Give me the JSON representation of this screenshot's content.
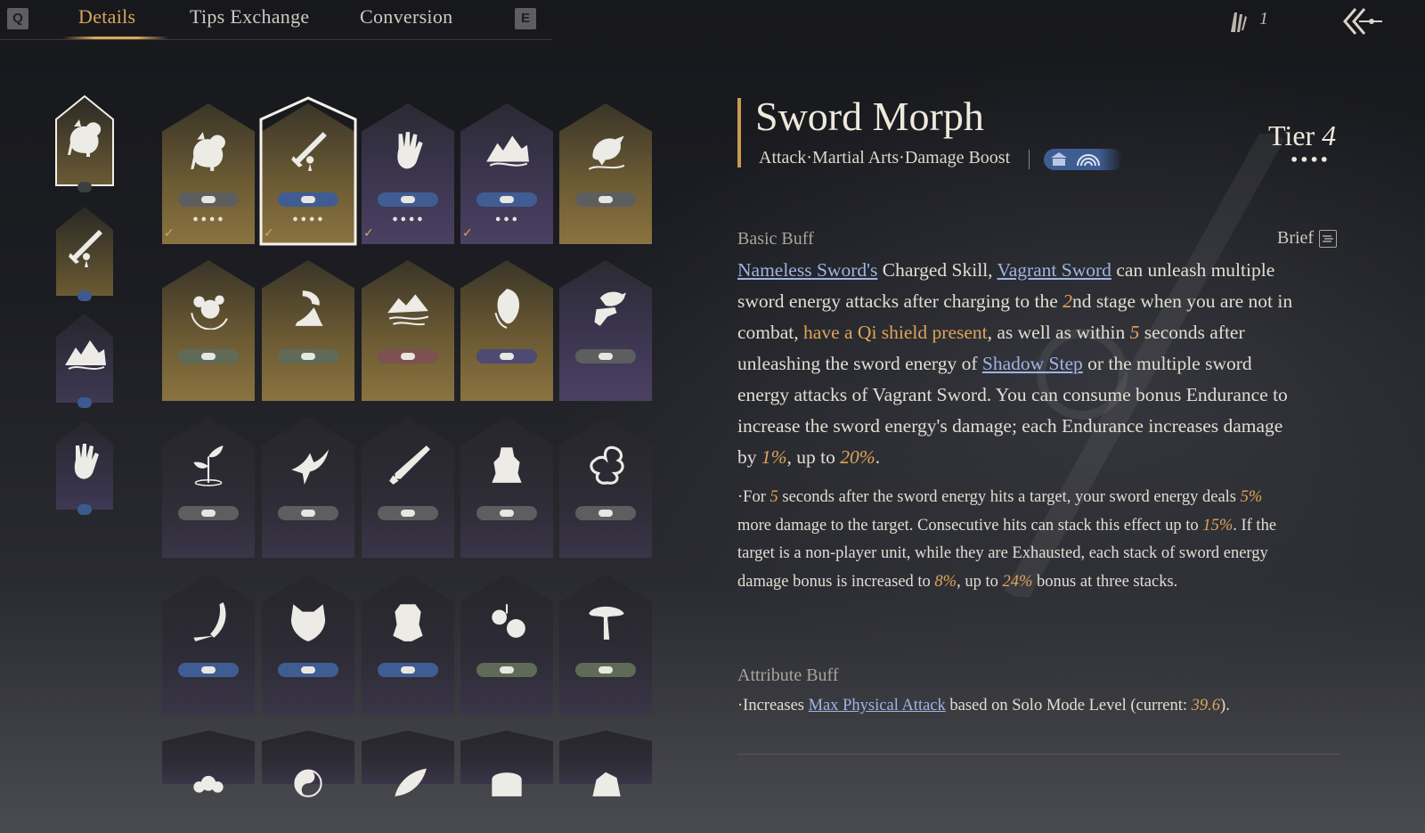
{
  "topbar": {
    "left_key": "Q",
    "right_key": "E",
    "tabs": [
      "Details",
      "Tips Exchange",
      "Conversion"
    ],
    "active_tab": 0,
    "resource_count": "1",
    "resource_icon": "feather-icon",
    "back_icon": "double-arrow-back-icon"
  },
  "sidebar": [
    {
      "icon": "ox-icon",
      "selected": true
    },
    {
      "icon": "sword-icon",
      "selected": false
    },
    {
      "icon": "mountain-icon",
      "selected": false
    },
    {
      "icon": "hand-icon",
      "selected": false
    }
  ],
  "grid": [
    [
      {
        "icon": "ox-icon",
        "bg": "gold",
        "pill": "grey",
        "dots": "••••",
        "check": true
      },
      {
        "icon": "sword-icon",
        "bg": "gold",
        "pill": "blue",
        "dots": "••••",
        "check": true,
        "selected": true
      },
      {
        "icon": "hand-icon",
        "bg": "purple",
        "pill": "blue",
        "dots": "••••",
        "check": true
      },
      {
        "icon": "mountain-icon",
        "bg": "purple",
        "pill": "blue",
        "dots": "•••",
        "check": true
      },
      {
        "icon": "crane-icon",
        "bg": "gold",
        "pill": "grey",
        "dots": "",
        "check": false
      }
    ],
    [
      {
        "icon": "flower-icon",
        "bg": "gold",
        "pill": "green",
        "dots": "",
        "check": false
      },
      {
        "icon": "water-pour-icon",
        "bg": "gold",
        "pill": "green",
        "dots": "",
        "check": false
      },
      {
        "icon": "landscape-icon",
        "bg": "gold",
        "pill": "red",
        "dots": "",
        "check": false
      },
      {
        "icon": "mask-face-icon",
        "bg": "gold",
        "pill": "violet",
        "dots": "",
        "check": false
      },
      {
        "icon": "bird-on-hand-icon",
        "bg": "purple",
        "pill": "grey",
        "dots": "",
        "check": false
      }
    ],
    [
      {
        "icon": "sprout-icon",
        "bg": "dark",
        "pill": "grey",
        "dots": "",
        "check": false
      },
      {
        "icon": "swallow-icon",
        "bg": "dark",
        "pill": "grey",
        "dots": "",
        "check": false
      },
      {
        "icon": "blade-icon",
        "bg": "dark",
        "pill": "grey",
        "dots": "",
        "check": false
      },
      {
        "icon": "statue-icon",
        "bg": "dark",
        "pill": "grey",
        "dots": "",
        "check": false
      },
      {
        "icon": "dragon-icon",
        "bg": "dark",
        "pill": "grey",
        "dots": "",
        "check": false
      }
    ],
    [
      {
        "icon": "scythe-icon",
        "bg": "dark",
        "pill": "blue",
        "dots": "",
        "check": false
      },
      {
        "icon": "wolf-icon",
        "bg": "dark",
        "pill": "blue",
        "dots": "",
        "check": false
      },
      {
        "icon": "armor-icon",
        "bg": "dark",
        "pill": "blue",
        "dots": "",
        "check": false
      },
      {
        "icon": "gourd-icon",
        "bg": "dark",
        "pill": "green",
        "dots": "",
        "check": false
      },
      {
        "icon": "tree-icon",
        "bg": "dark",
        "pill": "green",
        "dots": "",
        "check": false
      }
    ],
    [
      {
        "icon": "blossom-icon",
        "bg": "dark",
        "pill": "",
        "dots": "",
        "check": false
      },
      {
        "icon": "yin-yang-icon",
        "bg": "dark",
        "pill": "",
        "dots": "",
        "check": false
      },
      {
        "icon": "leaf-icon",
        "bg": "dark",
        "pill": "",
        "dots": "",
        "check": false
      },
      {
        "icon": "helmet-icon",
        "bg": "dark",
        "pill": "",
        "dots": "",
        "check": false
      },
      {
        "icon": "rock-icon",
        "bg": "dark",
        "pill": "",
        "dots": "",
        "check": false
      }
    ]
  ],
  "detail": {
    "title": "Sword Morph",
    "subtitle": "Attack·Martial Arts·Damage Boost",
    "tier_label": "Tier",
    "tier_value": "4",
    "tier_dots": "••••",
    "basic_buff_heading": "Basic Buff",
    "brief_label": "Brief",
    "basic_buff": {
      "link1": "Nameless Sword's",
      "t1": " Charged Skill, ",
      "link2": "Vagrant Sword",
      "t2": " can unleash multiple sword energy attacks after charging to the ",
      "n1": "2",
      "t3": "nd stage when you are not in combat, ",
      "hl1": "have a Qi shield present",
      "t4": ", as well as within ",
      "n2": "5",
      "t5": " seconds after unleashing the sword energy of ",
      "link3": "Shadow Step",
      "t6": " or the multiple sword energy attacks of Vagrant Sword. You can consume bonus Endurance to increase the sword energy's damage; each Endurance increases damage by ",
      "n3": "1%",
      "t7": ", up to ",
      "n4": "20%",
      "t8": "."
    },
    "bullet": {
      "t1": "·For ",
      "n1": "5",
      "t2": " seconds after the sword energy hits a target, your sword energy deals ",
      "n2": "5%",
      "t3": " more damage to the target. Consecutive hits can stack this effect up to ",
      "n3": "15%",
      "t4": ". If the target is a non-player unit, while they are Exhausted, each stack of sword energy damage bonus is increased to ",
      "n4": "8%",
      "t5": ", up to ",
      "n5": "24%",
      "t6": " bonus at three stacks."
    },
    "attribute_buff_heading": "Attribute Buff",
    "attribute": {
      "t1": "·Increases ",
      "link": "Max Physical Attack",
      "t2": " based on Solo Mode Level (current: ",
      "n1": "39.6",
      "t3": ")."
    }
  },
  "colors": {
    "accent_gold": "#d9a659",
    "link_blue": "#9fb4e3",
    "highlight_orange": "#e0a458"
  }
}
